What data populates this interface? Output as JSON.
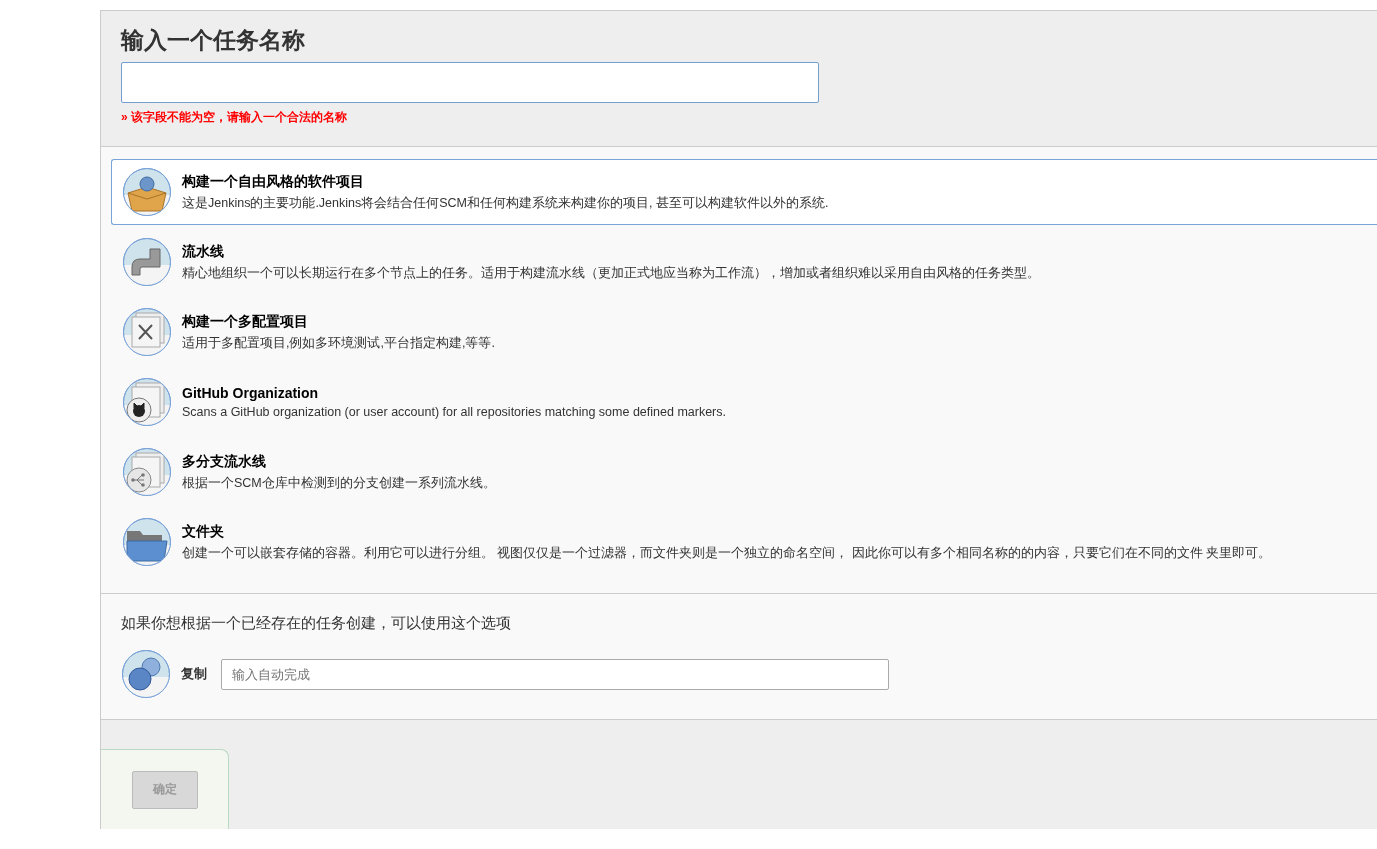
{
  "name_section": {
    "title": "输入一个任务名称",
    "error": "» 该字段不能为空，请输入一个合法的名称"
  },
  "items": [
    {
      "kind": "freestyle",
      "title": "构建一个自由风格的软件项目",
      "description": "这是Jenkins的主要功能.Jenkins将会结合任何SCM和任何构建系统来构建你的项目, 甚至可以构建软件以外的系统.",
      "selected": true
    },
    {
      "kind": "pipeline",
      "title": "流水线",
      "description": "精心地组织一个可以长期运行在多个节点上的任务。适用于构建流水线（更加正式地应当称为工作流），增加或者组织难以采用自由风格的任务类型。",
      "selected": false
    },
    {
      "kind": "matrix",
      "title": "构建一个多配置项目",
      "description": "适用于多配置项目,例如多环境测试,平台指定构建,等等.",
      "selected": false
    },
    {
      "kind": "github",
      "title": "GitHub Organization",
      "description": "Scans a GitHub organization (or user account) for all repositories matching some defined markers.",
      "selected": false
    },
    {
      "kind": "multibranch",
      "title": "多分支流水线",
      "description": "根据一个SCM仓库中检测到的分支创建一系列流水线。",
      "selected": false
    },
    {
      "kind": "folder",
      "title": "文件夹",
      "description": "创建一个可以嵌套存储的容器。利用它可以进行分组。 视图仅仅是一个过滤器，而文件夹则是一个独立的命名空间， 因此你可以有多个相同名称的的内容，只要它们在不同的文件 夹里即可。",
      "selected": false
    }
  ],
  "copy_section": {
    "hint": "如果你想根据一个已经存在的任务创建，可以使用这个选项",
    "label": "复制",
    "placeholder": "输入自动完成"
  },
  "ok_button": {
    "label": "确定",
    "disabled": true
  }
}
